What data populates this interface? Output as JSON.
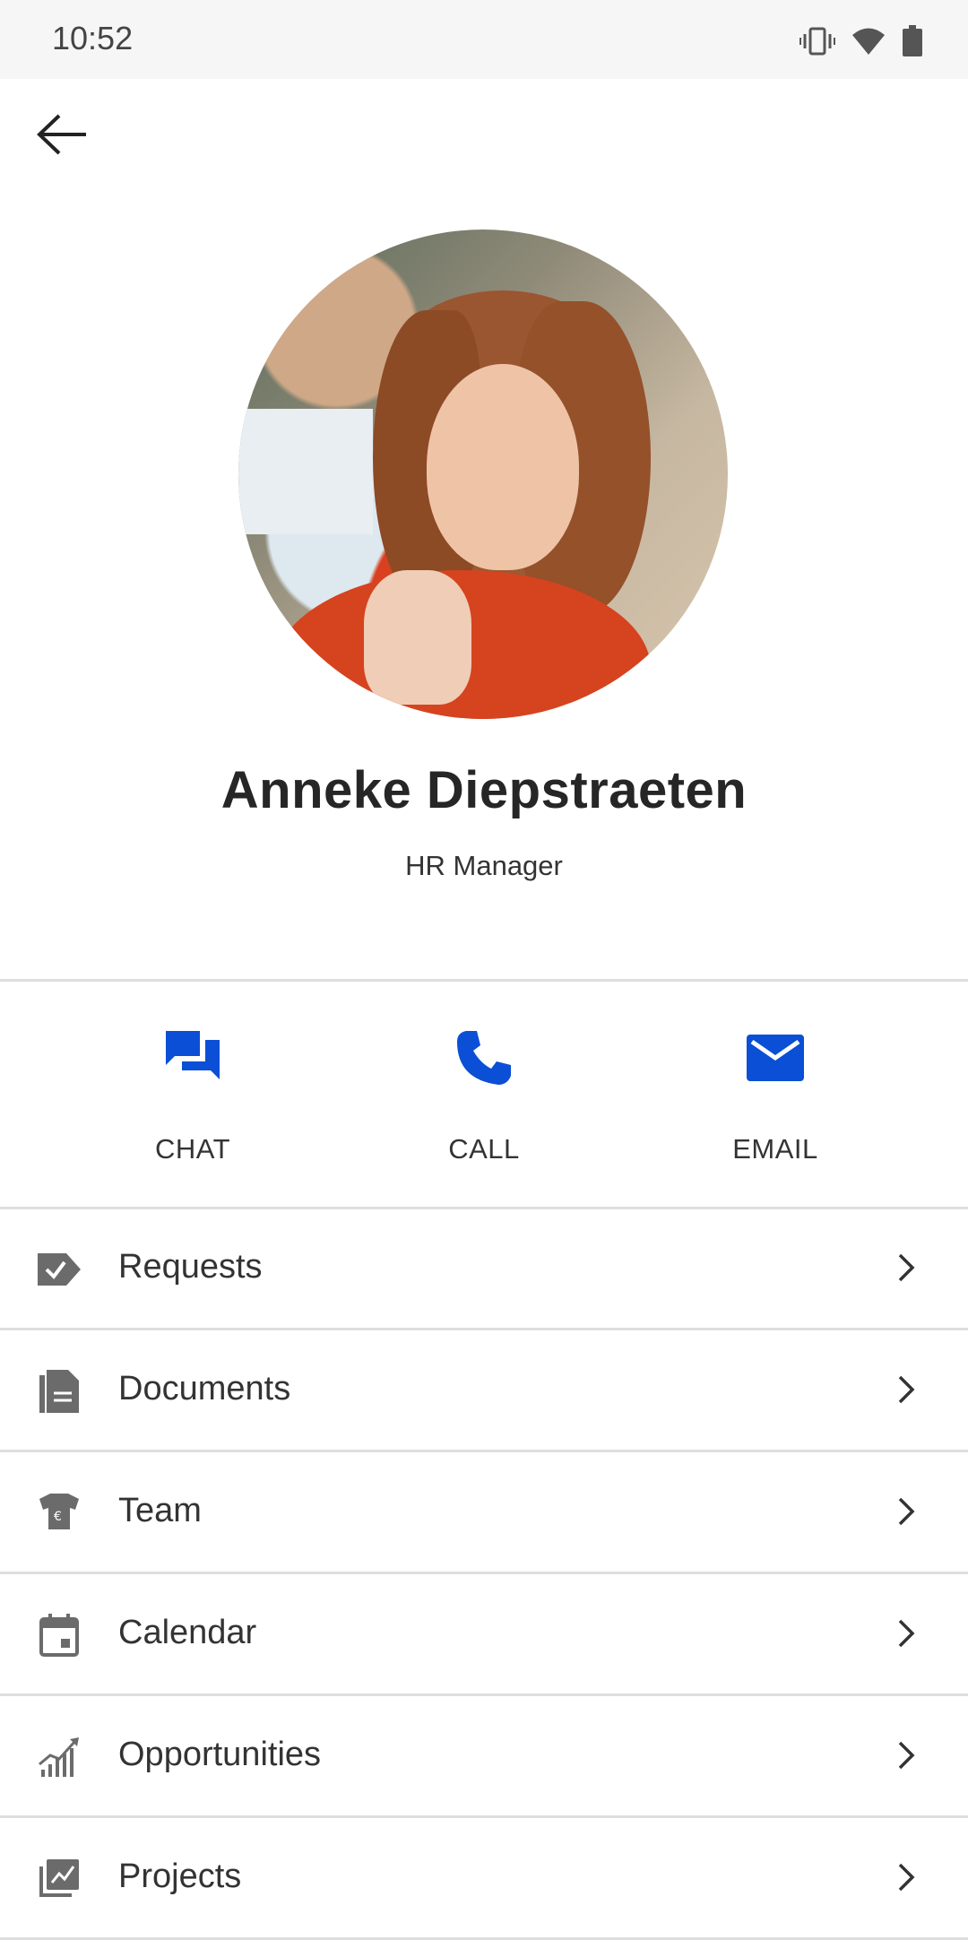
{
  "status_bar": {
    "time": "10:52",
    "icons": [
      "vibrate-icon",
      "wifi-icon",
      "battery-icon"
    ]
  },
  "header": {
    "back_icon": "arrow-left-icon"
  },
  "profile": {
    "name": "Anneke Diepstraeten",
    "title": "HR Manager"
  },
  "actions": [
    {
      "label": "CHAT",
      "icon": "chat-icon"
    },
    {
      "label": "CALL",
      "icon": "phone-icon"
    },
    {
      "label": "EMAIL",
      "icon": "email-icon"
    }
  ],
  "menu": [
    {
      "label": "Requests",
      "icon": "request-icon"
    },
    {
      "label": "Documents",
      "icon": "documents-icon"
    },
    {
      "label": "Team",
      "icon": "team-icon"
    },
    {
      "label": "Calendar",
      "icon": "calendar-icon"
    },
    {
      "label": "Opportunities",
      "icon": "opportunities-icon"
    },
    {
      "label": "Projects",
      "icon": "projects-icon"
    }
  ],
  "colors": {
    "accent": "#0a4fd6",
    "icon_gray": "#6b6b6b",
    "divider": "#dedede"
  }
}
